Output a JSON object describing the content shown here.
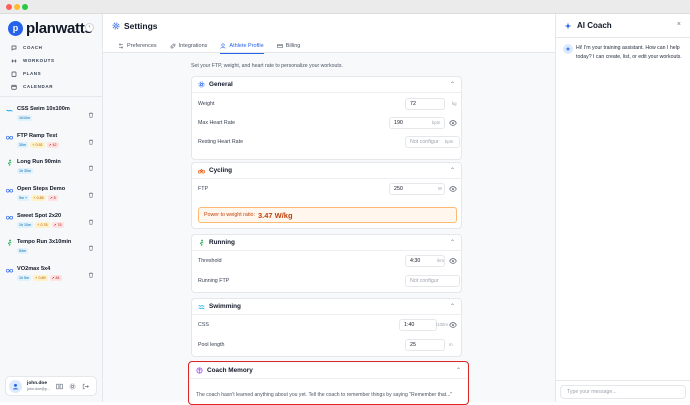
{
  "app": {
    "brand": "planwatts",
    "accent": "#2563eb"
  },
  "nav": [
    {
      "label": "COACH",
      "icon": "chat-icon"
    },
    {
      "label": "WORKOUTS",
      "icon": "dumbbell-icon"
    },
    {
      "label": "PLANS",
      "icon": "clipboard-icon"
    },
    {
      "label": "CALENDAR",
      "icon": "calendar-icon"
    }
  ],
  "workouts": [
    {
      "title": "CSS Swim 10x100m",
      "duration": "1h10m",
      "if": "",
      "tss": ""
    },
    {
      "title": "FTP Ramp Test",
      "duration": "30m",
      "if": "0.92",
      "tss": "42"
    },
    {
      "title": "Long Run 90min",
      "duration": "1h 30m",
      "if": "",
      "tss": ""
    },
    {
      "title": "Open Steps Demo",
      "duration": "5m +",
      "if": "0.85",
      "tss": "8"
    },
    {
      "title": "Sweet Spot 2x20",
      "duration": "1h 10m",
      "if": "0.78",
      "tss": "78"
    },
    {
      "title": "Tempo Run 3x10min",
      "duration": "54m",
      "if": "",
      "tss": ""
    },
    {
      "title": "VO2max 5x4",
      "duration": "1h 5m",
      "if": "0.89",
      "tss": "84"
    }
  ],
  "user": {
    "name": "john.doe",
    "email": "john.doe@p..."
  },
  "header": {
    "title": "Settings"
  },
  "tabs": [
    {
      "label": "Preferences",
      "icon": "sliders-icon",
      "active": false
    },
    {
      "label": "Integrations",
      "icon": "link-icon",
      "active": false
    },
    {
      "label": "Athlete Profile",
      "icon": "person-icon",
      "active": true
    },
    {
      "label": "Billing",
      "icon": "credit-card-icon",
      "active": false
    }
  ],
  "intro": "Set your FTP, weight, and heart rate to personalize your workouts.",
  "general": {
    "title": "General",
    "weight_label": "Weight",
    "weight_value": "72",
    "weight_unit": "kg",
    "maxhr_label": "Max Heart Rate",
    "maxhr_value": "190",
    "maxhr_unit": "bpm",
    "resthr_label": "Resting Heart Rate",
    "resthr_placeholder": "Not configur",
    "resthr_unit": "bpm"
  },
  "cycling": {
    "title": "Cycling",
    "ftp_label": "FTP",
    "ftp_value": "250",
    "ftp_unit": "W",
    "ratio_label": "Power to weight ratio:",
    "ratio_value": "3.47 W/kg"
  },
  "running": {
    "title": "Running",
    "threshold_label": "Threshold",
    "threshold_value": "4:30",
    "threshold_unit": "/km",
    "rftp_label": "Running FTP",
    "rftp_placeholder": "Not configur"
  },
  "swimming": {
    "title": "Swimming",
    "css_label": "CSS",
    "css_value": "1:40",
    "css_unit": "/100m",
    "pool_label": "Pool length",
    "pool_value": "25",
    "pool_unit": "m"
  },
  "memory": {
    "title": "Coach Memory",
    "text": "The coach hasn't learned anything about you yet. Tell the coach to remember things by saying \"Remember that...\""
  },
  "coach": {
    "title": "AI Coach",
    "message": "Hi! I'm your training assistant. How can I help today? I can create, list, or edit your workouts.",
    "input_placeholder": "Type your message..."
  }
}
